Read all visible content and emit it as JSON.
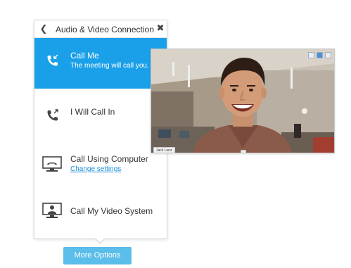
{
  "panel": {
    "title": "Audio & Video Connection",
    "back_icon": "chevron-left-icon",
    "close_icon": "close-icon",
    "options": [
      {
        "label": "Call Me",
        "sublabel": "The meeting will call you.",
        "icon": "phone-incoming-icon",
        "selected": true
      },
      {
        "label": "I Will Call In",
        "icon": "phone-outgoing-icon",
        "selected": false
      },
      {
        "label": "Call Using Computer",
        "link": "Change settings",
        "icon": "computer-phone-icon",
        "selected": false
      },
      {
        "label": "Call My Video System",
        "icon": "video-system-icon",
        "selected": false
      }
    ]
  },
  "more_options": {
    "label": "More Options"
  },
  "video": {
    "participant_name": "Jack Lenz",
    "controls": [
      "layout-icon",
      "grid-icon",
      "expand-icon"
    ]
  },
  "colors": {
    "accent": "#1aa0e8",
    "button": "#5bbde9",
    "link": "#1a8fd6"
  }
}
